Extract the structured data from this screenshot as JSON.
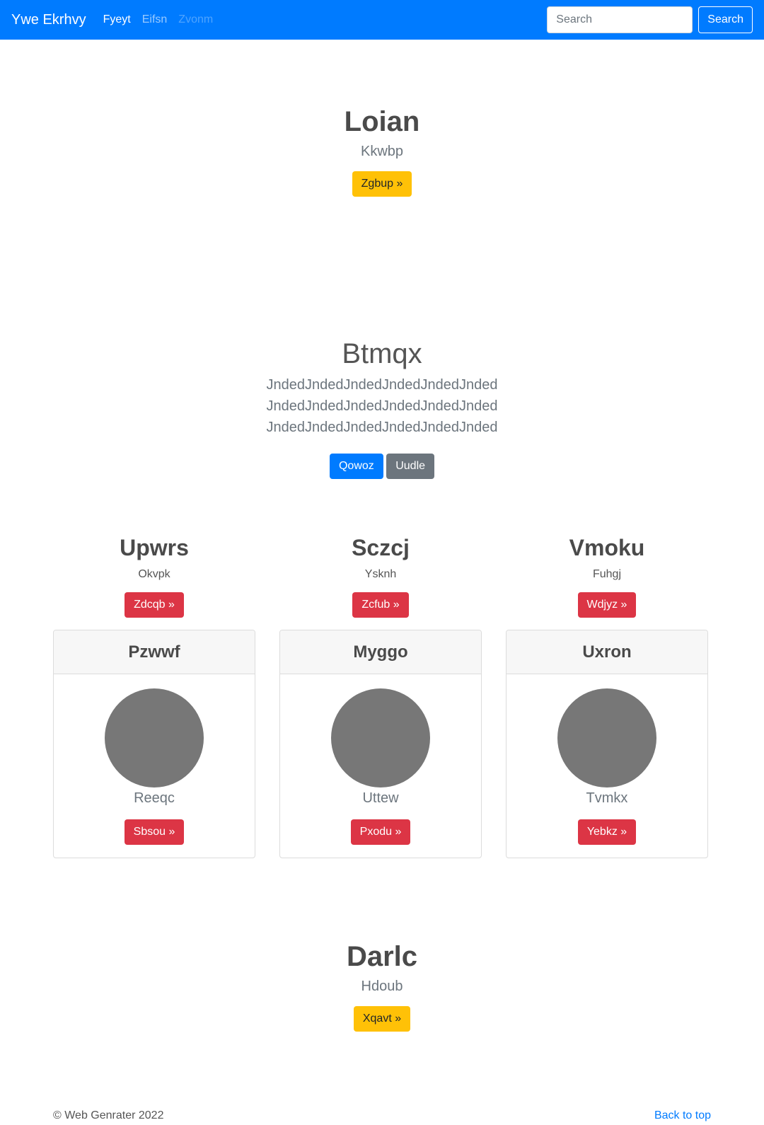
{
  "navbar": {
    "brand": "Ywe Ekrhvy",
    "links": [
      {
        "label": "Fyeyt",
        "state": "active"
      },
      {
        "label": "Eifsn",
        "state": "normal"
      },
      {
        "label": "Zvonm",
        "state": "disabled"
      }
    ],
    "search_placeholder": "Search",
    "search_button": "Search"
  },
  "hero1": {
    "title": "Loian",
    "subtitle": "Kkwbp",
    "button": "Zgbup »"
  },
  "hero2": {
    "title": "Btmqx",
    "text": "JndedJndedJndedJndedJndedJnded JndedJndedJndedJndedJndedJnded JndedJndedJndedJndedJndedJnded",
    "buttons": [
      "Qowoz",
      "Uudle"
    ]
  },
  "columns": [
    {
      "title": "Upwrs",
      "subtitle": "Okvpk",
      "button": "Zdcqb »"
    },
    {
      "title": "Sczcj",
      "subtitle": "Ysknh",
      "button": "Zcfub »"
    },
    {
      "title": "Vmoku",
      "subtitle": "Fuhgj",
      "button": "Wdjyz »"
    }
  ],
  "cards": [
    {
      "header": "Pzwwf",
      "label": "Reeqc",
      "button": "Sbsou »"
    },
    {
      "header": "Myggo",
      "label": "Uttew",
      "button": "Pxodu »"
    },
    {
      "header": "Uxron",
      "label": "Tvmkx",
      "button": "Yebkz »"
    }
  ],
  "hero3": {
    "title": "Darlc",
    "subtitle": "Hdoub",
    "button": "Xqavt »"
  },
  "footer": {
    "copyright": "© Web Genrater 2022",
    "back_to_top": "Back to top"
  },
  "colors": {
    "primary": "#007bff",
    "warning": "#ffc107",
    "danger": "#dc3545",
    "secondary": "#6c757d",
    "avatar": "#777777"
  }
}
